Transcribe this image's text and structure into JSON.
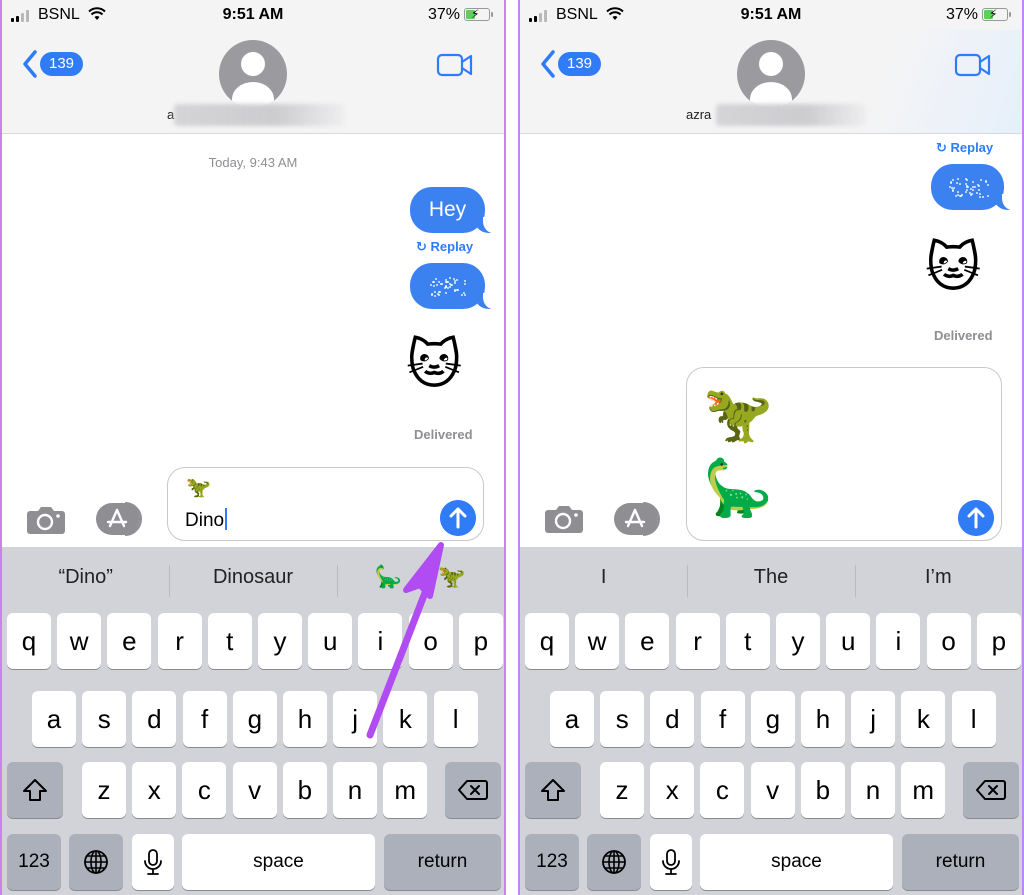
{
  "screens": [
    {
      "status": {
        "carrier": "BSNL",
        "time": "9:51 AM",
        "battery": "37%"
      },
      "header": {
        "back_count": "139",
        "contact_name_visible": "a"
      },
      "chat": {
        "timestamp": "Today, 9:43 AM",
        "messages": [
          {
            "type": "text",
            "text": "Hey"
          },
          {
            "type": "effect",
            "replay_label": "Replay"
          },
          {
            "type": "emoji",
            "text": "🐱"
          }
        ],
        "status": "Delivered"
      },
      "compose": {
        "emoji": "🦖",
        "text": "Dino"
      },
      "keyboard": {
        "suggestions": [
          "“Dino”",
          "Dinosaur",
          "🦕  🦖"
        ],
        "row1": [
          "q",
          "w",
          "e",
          "r",
          "t",
          "y",
          "u",
          "i",
          "o",
          "p"
        ],
        "row2": [
          "a",
          "s",
          "d",
          "f",
          "g",
          "h",
          "j",
          "k",
          "l"
        ],
        "row3": [
          "z",
          "x",
          "c",
          "v",
          "b",
          "n",
          "m"
        ],
        "numbers_label": "123",
        "space_label": "space",
        "return_label": "return"
      }
    },
    {
      "status": {
        "carrier": "BSNL",
        "time": "9:51 AM",
        "battery": "37%"
      },
      "header": {
        "back_count": "139",
        "contact_name_visible": "azra"
      },
      "chat": {
        "messages": [
          {
            "type": "effect",
            "replay_label": "Replay"
          },
          {
            "type": "emoji",
            "text": "🐱"
          }
        ],
        "status": "Delivered"
      },
      "compose": {
        "emoji_1": "🦖",
        "emoji_2": "🦕"
      },
      "keyboard": {
        "suggestions": [
          "I",
          "The",
          "I’m"
        ],
        "row1": [
          "q",
          "w",
          "e",
          "r",
          "t",
          "y",
          "u",
          "i",
          "o",
          "p"
        ],
        "row2": [
          "a",
          "s",
          "d",
          "f",
          "g",
          "h",
          "j",
          "k",
          "l"
        ],
        "row3": [
          "z",
          "x",
          "c",
          "v",
          "b",
          "n",
          "m"
        ],
        "numbers_label": "123",
        "space_label": "space",
        "return_label": "return"
      }
    }
  ],
  "annotation": {
    "type": "arrow",
    "color": "#b04cf2",
    "points_to": "emoji suggestion"
  },
  "colors": {
    "accent": "#2f7cf6",
    "bubble": "#3b82f0",
    "keyboard_bg": "#d1d3d9",
    "fn_key": "#abb0bb"
  }
}
